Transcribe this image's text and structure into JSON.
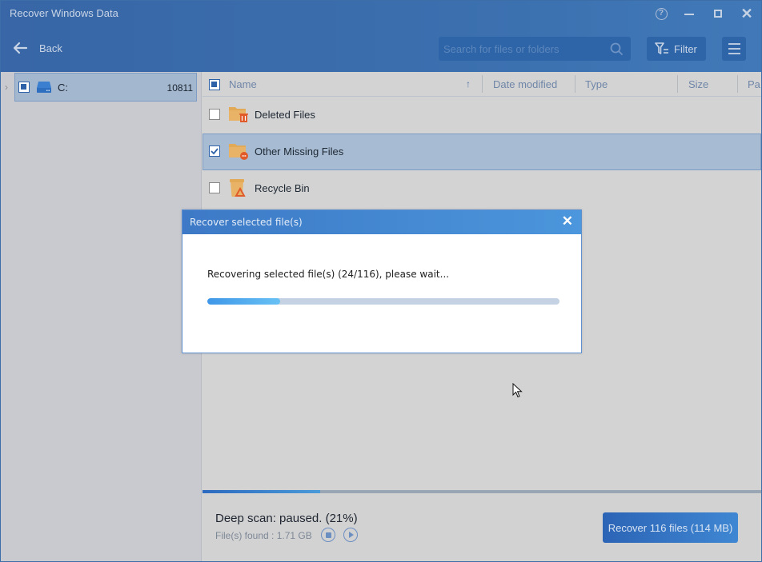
{
  "window": {
    "title": "Recover Windows Data",
    "controls": [
      "help",
      "minimize",
      "maximize",
      "close"
    ]
  },
  "toolbar": {
    "back_label": "Back",
    "search_placeholder": "Search for files or folders",
    "search_value": "",
    "filter_label": "Filter"
  },
  "tree": {
    "items": [
      {
        "label": "C:",
        "count": "10811",
        "checked": "partial",
        "expanded": false,
        "icon": "drive-icon"
      }
    ]
  },
  "list": {
    "columns": [
      "Name",
      "Date modified",
      "Type",
      "Size",
      "Pa"
    ],
    "sort": {
      "column": "Name",
      "direction": "ascending"
    },
    "rows": [
      {
        "name": "Deleted Files",
        "checked": false,
        "selected": false,
        "icon": "deleted-folder-icon"
      },
      {
        "name": "Other Missing Files",
        "checked": true,
        "selected": true,
        "icon": "missing-folder-icon"
      },
      {
        "name": "Recycle Bin",
        "checked": false,
        "selected": false,
        "icon": "recycle-bin-icon"
      }
    ]
  },
  "status": {
    "scan_text": "Deep scan: paused. (21%)",
    "scan_progress_percent": 21,
    "found_text": "File(s) found : 1.71 GB",
    "recover_label": "Recover 116 files (114 MB)"
  },
  "dialog": {
    "title": "Recover selected file(s)",
    "message": "Recovering selected file(s) (24/116), please wait...",
    "progress_current": 24,
    "progress_total": 116
  },
  "colors": {
    "header_bg": "#3b6fae",
    "accent": "#2d62a8",
    "selection": "#a7bbd2",
    "folder": "#e2a957",
    "badge": "#e05a2a"
  }
}
